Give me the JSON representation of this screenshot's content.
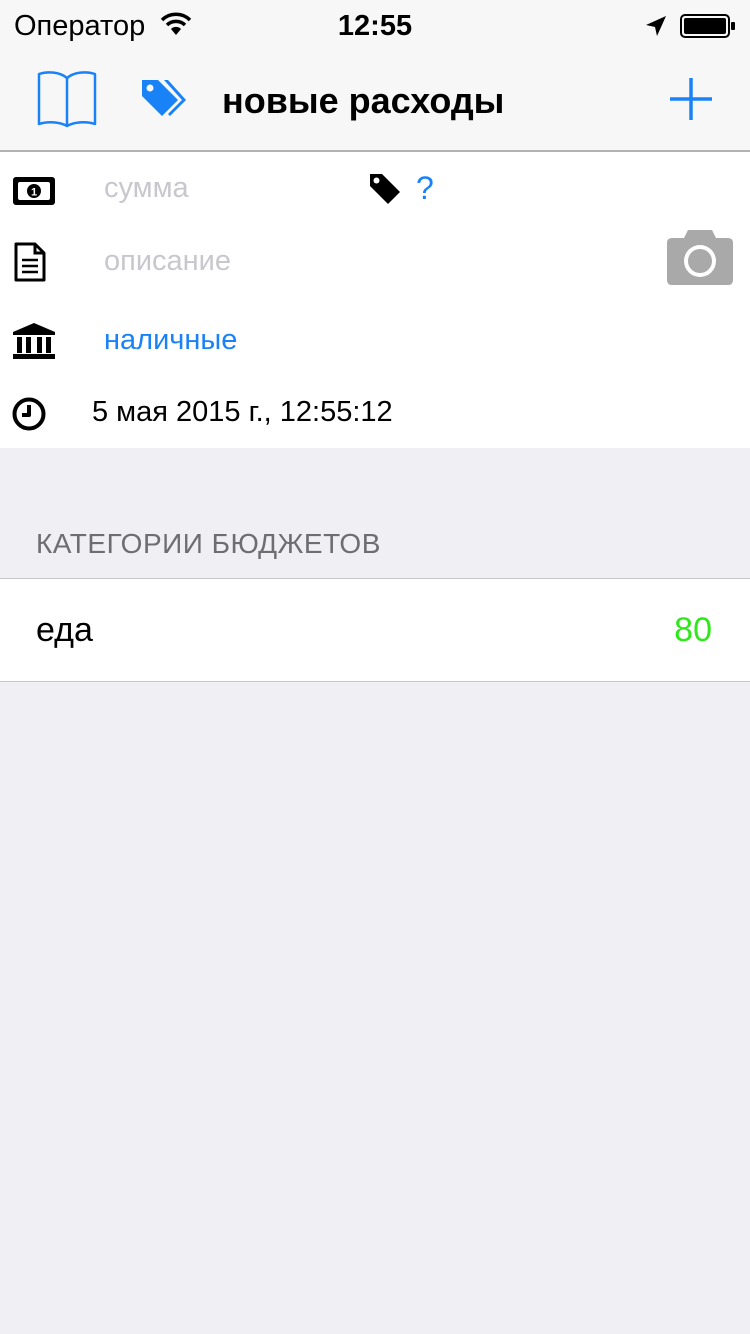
{
  "status_bar": {
    "carrier": "Оператор",
    "time": "12:55",
    "icons": [
      "wifi-icon",
      "location-arrow-icon",
      "battery-icon"
    ]
  },
  "nav": {
    "title": "новые расходы",
    "left_icons": [
      "book-icon",
      "tags-icon"
    ],
    "right_icon": "plus-icon"
  },
  "form": {
    "amount_placeholder": "сумма",
    "tag_value": "?",
    "description_placeholder": "описание",
    "account": "наличные",
    "datetime": "5 мая 2015 г., 12:55:12"
  },
  "budget": {
    "header": "КАТЕГОРИИ БЮДЖЕТОВ",
    "items": [
      {
        "label": "еда",
        "value": "80"
      }
    ]
  },
  "colors": {
    "accent": "#1a82f7",
    "positive": "#2ee81a",
    "placeholder": "#c7c7cd",
    "background": "#efeff4"
  }
}
